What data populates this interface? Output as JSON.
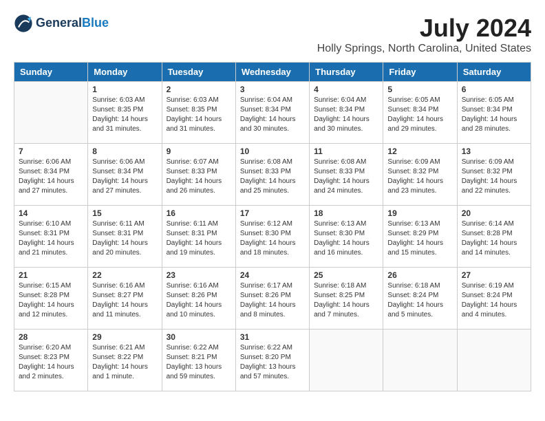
{
  "header": {
    "logo_line1": "General",
    "logo_line2": "Blue",
    "month": "July 2024",
    "location": "Holly Springs, North Carolina, United States"
  },
  "weekdays": [
    "Sunday",
    "Monday",
    "Tuesday",
    "Wednesday",
    "Thursday",
    "Friday",
    "Saturday"
  ],
  "weeks": [
    [
      {
        "day": "",
        "empty": true
      },
      {
        "day": "1",
        "sunrise": "6:03 AM",
        "sunset": "8:35 PM",
        "daylight": "14 hours and 31 minutes."
      },
      {
        "day": "2",
        "sunrise": "6:03 AM",
        "sunset": "8:35 PM",
        "daylight": "14 hours and 31 minutes."
      },
      {
        "day": "3",
        "sunrise": "6:04 AM",
        "sunset": "8:34 PM",
        "daylight": "14 hours and 30 minutes."
      },
      {
        "day": "4",
        "sunrise": "6:04 AM",
        "sunset": "8:34 PM",
        "daylight": "14 hours and 30 minutes."
      },
      {
        "day": "5",
        "sunrise": "6:05 AM",
        "sunset": "8:34 PM",
        "daylight": "14 hours and 29 minutes."
      },
      {
        "day": "6",
        "sunrise": "6:05 AM",
        "sunset": "8:34 PM",
        "daylight": "14 hours and 28 minutes."
      }
    ],
    [
      {
        "day": "7",
        "sunrise": "6:06 AM",
        "sunset": "8:34 PM",
        "daylight": "14 hours and 27 minutes."
      },
      {
        "day": "8",
        "sunrise": "6:06 AM",
        "sunset": "8:34 PM",
        "daylight": "14 hours and 27 minutes."
      },
      {
        "day": "9",
        "sunrise": "6:07 AM",
        "sunset": "8:33 PM",
        "daylight": "14 hours and 26 minutes."
      },
      {
        "day": "10",
        "sunrise": "6:08 AM",
        "sunset": "8:33 PM",
        "daylight": "14 hours and 25 minutes."
      },
      {
        "day": "11",
        "sunrise": "6:08 AM",
        "sunset": "8:33 PM",
        "daylight": "14 hours and 24 minutes."
      },
      {
        "day": "12",
        "sunrise": "6:09 AM",
        "sunset": "8:32 PM",
        "daylight": "14 hours and 23 minutes."
      },
      {
        "day": "13",
        "sunrise": "6:09 AM",
        "sunset": "8:32 PM",
        "daylight": "14 hours and 22 minutes."
      }
    ],
    [
      {
        "day": "14",
        "sunrise": "6:10 AM",
        "sunset": "8:31 PM",
        "daylight": "14 hours and 21 minutes."
      },
      {
        "day": "15",
        "sunrise": "6:11 AM",
        "sunset": "8:31 PM",
        "daylight": "14 hours and 20 minutes."
      },
      {
        "day": "16",
        "sunrise": "6:11 AM",
        "sunset": "8:31 PM",
        "daylight": "14 hours and 19 minutes."
      },
      {
        "day": "17",
        "sunrise": "6:12 AM",
        "sunset": "8:30 PM",
        "daylight": "14 hours and 18 minutes."
      },
      {
        "day": "18",
        "sunrise": "6:13 AM",
        "sunset": "8:30 PM",
        "daylight": "14 hours and 16 minutes."
      },
      {
        "day": "19",
        "sunrise": "6:13 AM",
        "sunset": "8:29 PM",
        "daylight": "14 hours and 15 minutes."
      },
      {
        "day": "20",
        "sunrise": "6:14 AM",
        "sunset": "8:28 PM",
        "daylight": "14 hours and 14 minutes."
      }
    ],
    [
      {
        "day": "21",
        "sunrise": "6:15 AM",
        "sunset": "8:28 PM",
        "daylight": "14 hours and 12 minutes."
      },
      {
        "day": "22",
        "sunrise": "6:16 AM",
        "sunset": "8:27 PM",
        "daylight": "14 hours and 11 minutes."
      },
      {
        "day": "23",
        "sunrise": "6:16 AM",
        "sunset": "8:26 PM",
        "daylight": "14 hours and 10 minutes."
      },
      {
        "day": "24",
        "sunrise": "6:17 AM",
        "sunset": "8:26 PM",
        "daylight": "14 hours and 8 minutes."
      },
      {
        "day": "25",
        "sunrise": "6:18 AM",
        "sunset": "8:25 PM",
        "daylight": "14 hours and 7 minutes."
      },
      {
        "day": "26",
        "sunrise": "6:18 AM",
        "sunset": "8:24 PM",
        "daylight": "14 hours and 5 minutes."
      },
      {
        "day": "27",
        "sunrise": "6:19 AM",
        "sunset": "8:24 PM",
        "daylight": "14 hours and 4 minutes."
      }
    ],
    [
      {
        "day": "28",
        "sunrise": "6:20 AM",
        "sunset": "8:23 PM",
        "daylight": "14 hours and 2 minutes."
      },
      {
        "day": "29",
        "sunrise": "6:21 AM",
        "sunset": "8:22 PM",
        "daylight": "14 hours and 1 minute."
      },
      {
        "day": "30",
        "sunrise": "6:22 AM",
        "sunset": "8:21 PM",
        "daylight": "13 hours and 59 minutes."
      },
      {
        "day": "31",
        "sunrise": "6:22 AM",
        "sunset": "8:20 PM",
        "daylight": "13 hours and 57 minutes."
      },
      {
        "day": "",
        "empty": true
      },
      {
        "day": "",
        "empty": true
      },
      {
        "day": "",
        "empty": true
      }
    ]
  ]
}
